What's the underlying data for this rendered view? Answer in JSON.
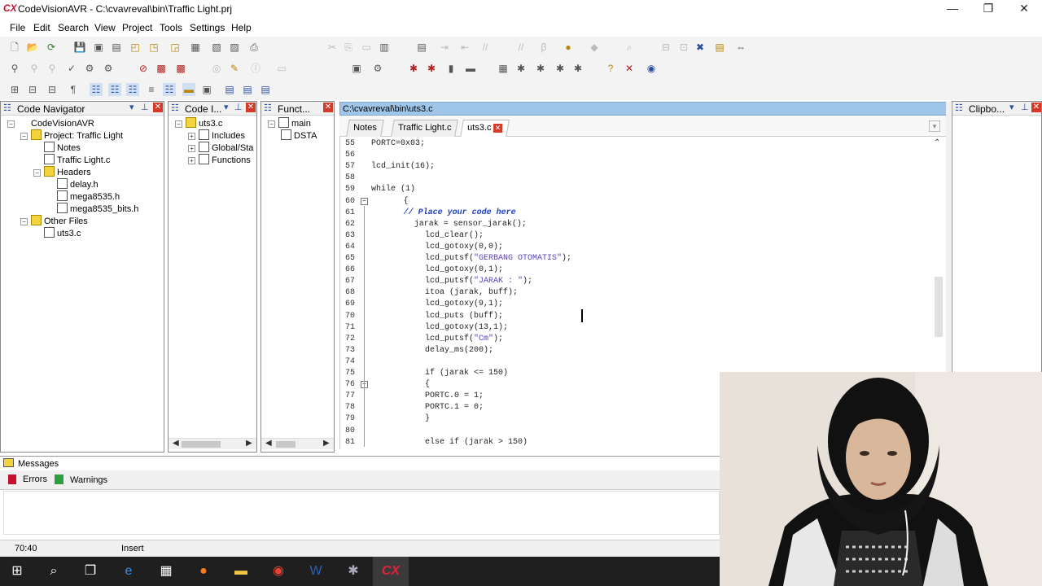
{
  "window": {
    "logo": "CX",
    "title": "CodeVisionAVR - C:\\cvavreval\\bin\\Traffic Light.prj",
    "minimize": "—",
    "maximize": "❐",
    "close": "✕"
  },
  "menu": [
    "File",
    "Edit",
    "Search",
    "View",
    "Project",
    "Tools",
    "Settings",
    "Help"
  ],
  "navigator": {
    "title": "Code Navigator",
    "items": [
      {
        "label": "CodeVisionAVR",
        "icon": "cvavr-icon",
        "depth": 0,
        "expander": "−"
      },
      {
        "label": "Project: Traffic Light",
        "icon": "folder-icon",
        "depth": 1,
        "expander": "−"
      },
      {
        "label": "Notes",
        "icon": "notes-icon",
        "depth": 2,
        "expander": ""
      },
      {
        "label": "Traffic Light.c",
        "icon": "file-icon",
        "depth": 2,
        "expander": ""
      },
      {
        "label": "Headers",
        "icon": "folder-icon",
        "depth": 2,
        "expander": "−"
      },
      {
        "label": "delay.h",
        "icon": "file-icon",
        "depth": 3,
        "expander": ""
      },
      {
        "label": "mega8535.h",
        "icon": "file-icon",
        "depth": 3,
        "expander": ""
      },
      {
        "label": "mega8535_bits.h",
        "icon": "file-icon",
        "depth": 3,
        "expander": ""
      },
      {
        "label": "Other Files",
        "icon": "folder-icon",
        "depth": 1,
        "expander": "−"
      },
      {
        "label": "uts3.c",
        "icon": "file-icon",
        "depth": 2,
        "expander": ""
      }
    ]
  },
  "codeinfo": {
    "title": "Code I...",
    "items": [
      {
        "label": "uts3.c",
        "expander": "−",
        "depth": 0
      },
      {
        "label": "Includes",
        "expander": "+",
        "depth": 1
      },
      {
        "label": "Global/Sta",
        "expander": "+",
        "depth": 1
      },
      {
        "label": "Functions",
        "expander": "+",
        "depth": 1
      }
    ]
  },
  "functions": {
    "title": "Funct...",
    "items": [
      {
        "label": "main",
        "expander": "−",
        "depth": 0
      },
      {
        "label": "DSTA",
        "expander": "",
        "depth": 1
      }
    ]
  },
  "clipboard": {
    "title": "Clipbo..."
  },
  "editor": {
    "path": "C:\\cvavreval\\bin\\uts3.c",
    "tabs": [
      "Notes",
      "Traffic Light.c",
      "uts3.c"
    ],
    "active_tab": 2,
    "lines": [
      {
        "n": "55",
        "t": "PORTC=0x03;",
        "i": 0
      },
      {
        "n": "56",
        "t": "",
        "i": 0
      },
      {
        "n": "57",
        "t": "lcd_init(16);",
        "i": 0
      },
      {
        "n": "58",
        "t": "",
        "i": 0
      },
      {
        "n": "59",
        "t": "while (1)",
        "i": 0
      },
      {
        "n": "60",
        "t": "{",
        "i": 6,
        "fold": "−"
      },
      {
        "n": "61",
        "t": "// Place your code here",
        "i": 6,
        "cls": "cmt"
      },
      {
        "n": "62",
        "t": "jarak = sensor_jarak();",
        "i": 8
      },
      {
        "n": "63",
        "t": "lcd_clear();",
        "i": 10
      },
      {
        "n": "64",
        "t": "lcd_gotoxy(0,0);",
        "i": 10
      },
      {
        "n": "65",
        "t": "lcd_putsf(\"GERBANG OTOMATIS\");",
        "i": 10,
        "str": "\"GERBANG OTOMATIS\""
      },
      {
        "n": "66",
        "t": "lcd_gotoxy(0,1);",
        "i": 10
      },
      {
        "n": "67",
        "t": "lcd_putsf(\"JARAK : \");",
        "i": 10,
        "str": "\"JARAK : \""
      },
      {
        "n": "68",
        "t": "itoa (jarak, buff);",
        "i": 10
      },
      {
        "n": "69",
        "t": "lcd_gotoxy(9,1);",
        "i": 10
      },
      {
        "n": "70",
        "t": "lcd_puts (buff);",
        "i": 10
      },
      {
        "n": "71",
        "t": "lcd_gotoxy(13,1);",
        "i": 10
      },
      {
        "n": "72",
        "t": "lcd_putsf(\"Cm\");",
        "i": 10,
        "str": "\"Cm\""
      },
      {
        "n": "73",
        "t": "delay_ms(200);",
        "i": 10
      },
      {
        "n": "74",
        "t": "",
        "i": 0
      },
      {
        "n": "75",
        "t": "if (jarak <= 150)",
        "i": 10
      },
      {
        "n": "76",
        "t": "{",
        "i": 10,
        "fold": "−"
      },
      {
        "n": "77",
        "t": "PORTC.0 = 1;",
        "i": 10
      },
      {
        "n": "78",
        "t": "PORTC.1 = 0;",
        "i": 10
      },
      {
        "n": "79",
        "t": "}",
        "i": 10
      },
      {
        "n": "80",
        "t": "",
        "i": 0
      },
      {
        "n": "81",
        "t": "else if (jarak > 150)",
        "i": 10
      }
    ]
  },
  "messages": {
    "title": "Messages",
    "errors": "Errors",
    "warnings": "Warnings"
  },
  "status": {
    "position": "70:40",
    "mode": "Insert"
  },
  "taskbar": [
    "windows-icon",
    "search-icon",
    "task-view-icon",
    "edge-icon",
    "store-icon",
    "firefox-icon",
    "file-explorer-icon",
    "chrome-icon",
    "word-icon",
    "avr-icon",
    "codevision-icon"
  ],
  "colors": {
    "accent": "#9fc5e8",
    "brand": "#c8102e",
    "taskbar": "#1f1f1f"
  }
}
